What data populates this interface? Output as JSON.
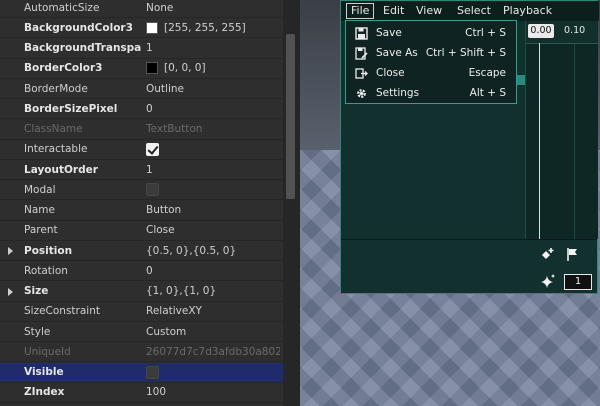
{
  "properties": [
    {
      "name": "AutomaticSize",
      "value": "None",
      "style": "normal"
    },
    {
      "name": "BackgroundColor3",
      "value": "[255, 255, 255]",
      "style": "bold",
      "swatch": "#ffffff"
    },
    {
      "name": "BackgroundTranspa...",
      "value": "1",
      "style": "bold"
    },
    {
      "name": "BorderColor3",
      "value": "[0, 0, 0]",
      "style": "bold",
      "swatch": "#000000"
    },
    {
      "name": "BorderMode",
      "value": "Outline",
      "style": "normal"
    },
    {
      "name": "BorderSizePixel",
      "value": "0",
      "style": "bold"
    },
    {
      "name": "ClassName",
      "value": "TextButton",
      "style": "dim"
    },
    {
      "name": "Interactable",
      "value": "",
      "style": "normal",
      "checkbox": "on"
    },
    {
      "name": "LayoutOrder",
      "value": "1",
      "style": "bold"
    },
    {
      "name": "Modal",
      "value": "",
      "style": "normal",
      "checkbox": "off"
    },
    {
      "name": "Name",
      "value": "Button",
      "style": "normal"
    },
    {
      "name": "Parent",
      "value": "Close",
      "style": "normal"
    },
    {
      "name": "Position",
      "value": "{0.5, 0},{0.5, 0}",
      "style": "bold",
      "expandable": true
    },
    {
      "name": "Rotation",
      "value": "0",
      "style": "normal"
    },
    {
      "name": "Size",
      "value": "{1, 0},{1, 0}",
      "style": "bold",
      "expandable": true
    },
    {
      "name": "SizeConstraint",
      "value": "RelativeXY",
      "style": "normal"
    },
    {
      "name": "Style",
      "value": "Custom",
      "style": "normal"
    },
    {
      "name": "UniqueId",
      "value": "26077d7c7d3afdb30a802...",
      "style": "dim"
    },
    {
      "name": "Visible",
      "value": "",
      "style": "bold",
      "checkbox": "off",
      "selected": true
    },
    {
      "name": "ZIndex",
      "value": "100",
      "style": "bold"
    }
  ],
  "editor": {
    "menus": [
      "File",
      "Edit",
      "View",
      "Select",
      "Playback"
    ],
    "current_time": "0.00",
    "tick_label": "0.10",
    "frame_value": "1",
    "icons": {
      "add_keyframe": "diamond-plus-icon",
      "flag": "flag-icon",
      "sparkle": "sparkle-icon"
    }
  },
  "file_menu": [
    {
      "label": "Save",
      "shortcut": "Ctrl + S",
      "icon": "save-icon"
    },
    {
      "label": "Save As",
      "shortcut": "Ctrl + Shift + S",
      "icon": "save-as-icon"
    },
    {
      "label": "Close",
      "shortcut": "Escape",
      "icon": "close-icon"
    },
    {
      "label": "Settings",
      "shortcut": "Alt + S",
      "icon": "gear-icon"
    }
  ],
  "colors": {
    "accent": "#2fa08c",
    "selection": "#1f2b6b",
    "panel": "#2e2e2e"
  }
}
